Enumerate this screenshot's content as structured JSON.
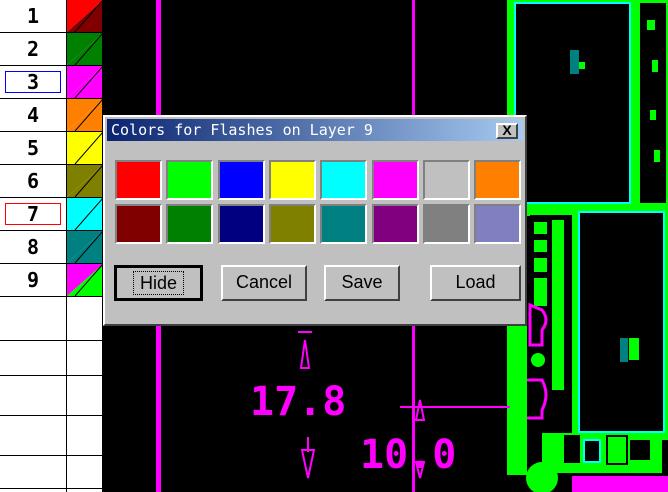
{
  "layers": [
    {
      "num": "1",
      "c1": "#ff0000",
      "c2": "#800000",
      "selected": false
    },
    {
      "num": "2",
      "c1": "#008000",
      "c2": "#008000",
      "selected": false
    },
    {
      "num": "3",
      "c1": "#ff00ff",
      "c2": "#ff00ff",
      "selected": true,
      "selected_color": "#0000ff"
    },
    {
      "num": "4",
      "c1": "#ff8000",
      "c2": "#ff8000",
      "selected": false
    },
    {
      "num": "5",
      "c1": "#ffff00",
      "c2": "#ffff00",
      "selected": false
    },
    {
      "num": "6",
      "c1": "#808000",
      "c2": "#808000",
      "selected": false
    },
    {
      "num": "7",
      "c1": "#00ffff",
      "c2": "#00ffff",
      "selected": true,
      "selected_color": "#ff0000"
    },
    {
      "num": "8",
      "c1": "#008080",
      "c2": "#008080",
      "selected": false
    },
    {
      "num": "9",
      "c1": "#ff00ff",
      "c2": "#00ff00",
      "selected": false
    }
  ],
  "dialog": {
    "title": "Colors for Flashes on Layer 9",
    "close_label": "X",
    "palette_row1": [
      "#ff0000",
      "#00ff00",
      "#0000ff",
      "#ffff00",
      "#00ffff",
      "#ff00ff",
      "#c0c0c0",
      "#ff8000"
    ],
    "palette_row2": [
      "#800000",
      "#008000",
      "#000080",
      "#808000",
      "#008080",
      "#800080",
      "#808080",
      "#8080c0"
    ],
    "buttons": {
      "hide": "Hide",
      "cancel": "Cancel",
      "save": "Save",
      "load": "Load"
    }
  },
  "canvas": {
    "dim_primary": "17.8",
    "dim_secondary": "10.0",
    "colors": {
      "trace": "#ff00ff",
      "pad": "#00ff00",
      "outline": "#00ffff",
      "background": "#000000"
    }
  }
}
